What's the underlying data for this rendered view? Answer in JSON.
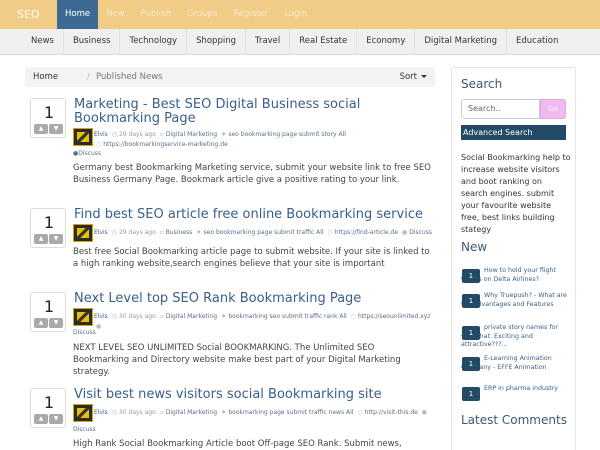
{
  "header": {
    "brand": "SEO",
    "nav": [
      "Home",
      "New",
      "Publish",
      "Groups",
      "Register",
      "Login"
    ]
  },
  "categories": [
    "News",
    "Business",
    "Technology",
    "Shopping",
    "Travel",
    "Real Estate",
    "Economy",
    "Digital Marketing",
    "Education"
  ],
  "breadcrumb": {
    "home": "Home",
    "separator": "/",
    "current": "Published News",
    "sort_label": "Sort"
  },
  "posts": [
    {
      "votes": "1",
      "title": "Marketing - Best SEO Digital Business social Bookmarking Page",
      "author": "Elvis",
      "time": "29 days ago",
      "category": "Digital Marketing",
      "tags": "seo bookmarking page submit story All",
      "url": "https://bookmarkingservice-marketing.de",
      "discuss": "Discuss",
      "description": "Germany best Bookmarking Marketing service, submit your website link to free SEO Business Germany Page. Bookmark article give a positive rating to your link."
    },
    {
      "votes": "1",
      "title": "Find best SEO article free online Bookmarking service",
      "author": "Elvis",
      "time": "29 days ago",
      "category": "Business",
      "tags": "seo bookmarking page submit traffic All",
      "url": "https://find-article.de",
      "discuss": "Discuss",
      "description": "Best free Social Bookmarking article page to submit website. If your site is linked to a high ranking website,search engines believe that your site is important"
    },
    {
      "votes": "1",
      "title": "Next Level top SEO Rank Bookmarking Page",
      "author": "Elvis",
      "time": "30 days ago",
      "category": "Digital Marketing",
      "tags": "bookmarking seo submit traffic rank All",
      "url": "https://seounlimited.xyz",
      "discuss": "Discuss",
      "description": "NEXT LEVEL SEO UNLIMITED Social BOOKMARKING. The Unlimited SEO Bookmarking and Directory website make best part of your Digital Marketing strategy."
    },
    {
      "votes": "1",
      "title": "Visit best news visitors social Bookmarking site",
      "author": "Elvis",
      "time": "30 days ago",
      "category": "Digital Marketing",
      "tags": "bookmarking page submit traffic news All",
      "url": "http://visit-this.de",
      "discuss": "Discuss",
      "description": "High Rank Social Bookmarking Article boot Off-page SEO Rank. Submit news, article,"
    }
  ],
  "sidebar": {
    "search_title": "Search",
    "search_placeholder": "Search..",
    "go_label": "Go",
    "advanced_search": "Advanced Search",
    "about": "Social Bookmarking help to increase website visitors and boot ranking on search engines. submit your favourite website free, best links building stategy",
    "new_title": "New",
    "new_items": [
      {
        "num": "1",
        "text": "How to hold your flight tickets on Delta Airlines?"
      },
      {
        "num": "1",
        "text": "Why Truepush? - What are the Advantages and Features"
      },
      {
        "num": "1",
        "text": "private story names for snapchat: Exciting and attractive???..."
      },
      {
        "num": "1",
        "text": "E-Learning Animation Company - EFFE Animation"
      },
      {
        "num": "1",
        "text": "ERP in pharma industry"
      }
    ],
    "comments_title": "Latest Comments"
  }
}
